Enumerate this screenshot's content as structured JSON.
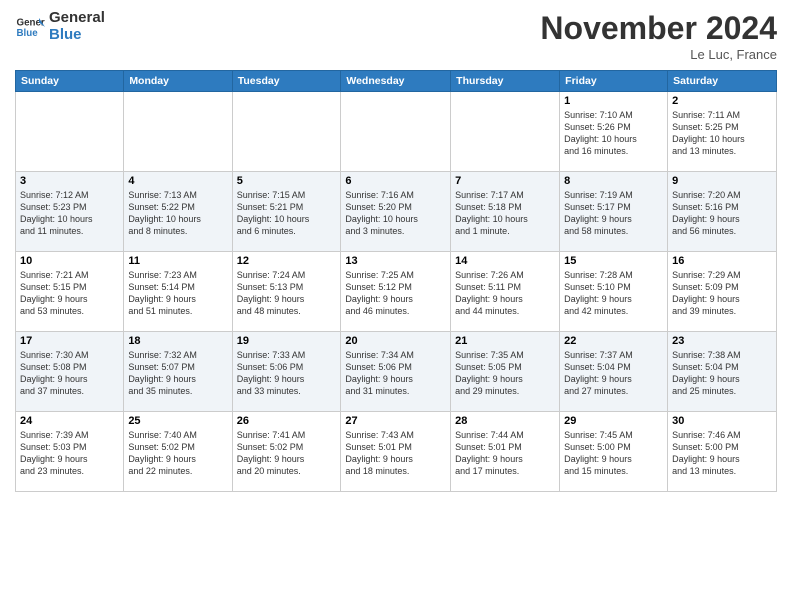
{
  "header": {
    "logo_line1": "General",
    "logo_line2": "Blue",
    "month": "November 2024",
    "location": "Le Luc, France"
  },
  "weekdays": [
    "Sunday",
    "Monday",
    "Tuesday",
    "Wednesday",
    "Thursday",
    "Friday",
    "Saturday"
  ],
  "weeks": [
    [
      {
        "day": "",
        "info": ""
      },
      {
        "day": "",
        "info": ""
      },
      {
        "day": "",
        "info": ""
      },
      {
        "day": "",
        "info": ""
      },
      {
        "day": "",
        "info": ""
      },
      {
        "day": "1",
        "info": "Sunrise: 7:10 AM\nSunset: 5:26 PM\nDaylight: 10 hours\nand 16 minutes."
      },
      {
        "day": "2",
        "info": "Sunrise: 7:11 AM\nSunset: 5:25 PM\nDaylight: 10 hours\nand 13 minutes."
      }
    ],
    [
      {
        "day": "3",
        "info": "Sunrise: 7:12 AM\nSunset: 5:23 PM\nDaylight: 10 hours\nand 11 minutes."
      },
      {
        "day": "4",
        "info": "Sunrise: 7:13 AM\nSunset: 5:22 PM\nDaylight: 10 hours\nand 8 minutes."
      },
      {
        "day": "5",
        "info": "Sunrise: 7:15 AM\nSunset: 5:21 PM\nDaylight: 10 hours\nand 6 minutes."
      },
      {
        "day": "6",
        "info": "Sunrise: 7:16 AM\nSunset: 5:20 PM\nDaylight: 10 hours\nand 3 minutes."
      },
      {
        "day": "7",
        "info": "Sunrise: 7:17 AM\nSunset: 5:18 PM\nDaylight: 10 hours\nand 1 minute."
      },
      {
        "day": "8",
        "info": "Sunrise: 7:19 AM\nSunset: 5:17 PM\nDaylight: 9 hours\nand 58 minutes."
      },
      {
        "day": "9",
        "info": "Sunrise: 7:20 AM\nSunset: 5:16 PM\nDaylight: 9 hours\nand 56 minutes."
      }
    ],
    [
      {
        "day": "10",
        "info": "Sunrise: 7:21 AM\nSunset: 5:15 PM\nDaylight: 9 hours\nand 53 minutes."
      },
      {
        "day": "11",
        "info": "Sunrise: 7:23 AM\nSunset: 5:14 PM\nDaylight: 9 hours\nand 51 minutes."
      },
      {
        "day": "12",
        "info": "Sunrise: 7:24 AM\nSunset: 5:13 PM\nDaylight: 9 hours\nand 48 minutes."
      },
      {
        "day": "13",
        "info": "Sunrise: 7:25 AM\nSunset: 5:12 PM\nDaylight: 9 hours\nand 46 minutes."
      },
      {
        "day": "14",
        "info": "Sunrise: 7:26 AM\nSunset: 5:11 PM\nDaylight: 9 hours\nand 44 minutes."
      },
      {
        "day": "15",
        "info": "Sunrise: 7:28 AM\nSunset: 5:10 PM\nDaylight: 9 hours\nand 42 minutes."
      },
      {
        "day": "16",
        "info": "Sunrise: 7:29 AM\nSunset: 5:09 PM\nDaylight: 9 hours\nand 39 minutes."
      }
    ],
    [
      {
        "day": "17",
        "info": "Sunrise: 7:30 AM\nSunset: 5:08 PM\nDaylight: 9 hours\nand 37 minutes."
      },
      {
        "day": "18",
        "info": "Sunrise: 7:32 AM\nSunset: 5:07 PM\nDaylight: 9 hours\nand 35 minutes."
      },
      {
        "day": "19",
        "info": "Sunrise: 7:33 AM\nSunset: 5:06 PM\nDaylight: 9 hours\nand 33 minutes."
      },
      {
        "day": "20",
        "info": "Sunrise: 7:34 AM\nSunset: 5:06 PM\nDaylight: 9 hours\nand 31 minutes."
      },
      {
        "day": "21",
        "info": "Sunrise: 7:35 AM\nSunset: 5:05 PM\nDaylight: 9 hours\nand 29 minutes."
      },
      {
        "day": "22",
        "info": "Sunrise: 7:37 AM\nSunset: 5:04 PM\nDaylight: 9 hours\nand 27 minutes."
      },
      {
        "day": "23",
        "info": "Sunrise: 7:38 AM\nSunset: 5:04 PM\nDaylight: 9 hours\nand 25 minutes."
      }
    ],
    [
      {
        "day": "24",
        "info": "Sunrise: 7:39 AM\nSunset: 5:03 PM\nDaylight: 9 hours\nand 23 minutes."
      },
      {
        "day": "25",
        "info": "Sunrise: 7:40 AM\nSunset: 5:02 PM\nDaylight: 9 hours\nand 22 minutes."
      },
      {
        "day": "26",
        "info": "Sunrise: 7:41 AM\nSunset: 5:02 PM\nDaylight: 9 hours\nand 20 minutes."
      },
      {
        "day": "27",
        "info": "Sunrise: 7:43 AM\nSunset: 5:01 PM\nDaylight: 9 hours\nand 18 minutes."
      },
      {
        "day": "28",
        "info": "Sunrise: 7:44 AM\nSunset: 5:01 PM\nDaylight: 9 hours\nand 17 minutes."
      },
      {
        "day": "29",
        "info": "Sunrise: 7:45 AM\nSunset: 5:00 PM\nDaylight: 9 hours\nand 15 minutes."
      },
      {
        "day": "30",
        "info": "Sunrise: 7:46 AM\nSunset: 5:00 PM\nDaylight: 9 hours\nand 13 minutes."
      }
    ]
  ]
}
